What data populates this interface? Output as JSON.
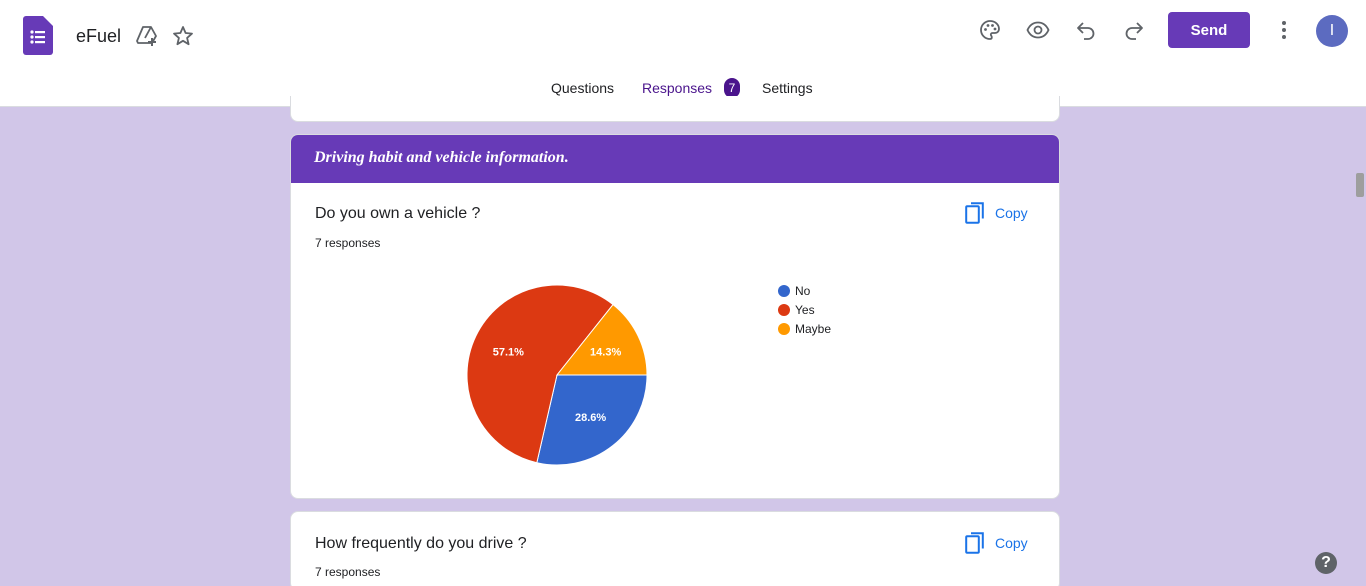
{
  "app": {
    "title": "eFuel",
    "avatar_initial": "I"
  },
  "toolbar": {
    "send_label": "Send"
  },
  "tabs": [
    {
      "label": "Questions",
      "active": false
    },
    {
      "label": "Responses",
      "active": true,
      "badge": "7"
    },
    {
      "label": "Settings",
      "active": false
    }
  ],
  "section": {
    "title": "Driving habit and vehicle information."
  },
  "questions": [
    {
      "title": "Do you own a vehicle ?",
      "responses": "7 responses",
      "copy_label": "Copy",
      "chart_data": {
        "type": "pie",
        "slices": [
          {
            "label": "No",
            "value": 28.6,
            "display": "28.6%",
            "color": "#3366cc"
          },
          {
            "label": "Yes",
            "value": 57.1,
            "display": "57.1%",
            "color": "#dc3912"
          },
          {
            "label": "Maybe",
            "value": 14.3,
            "display": "14.3%",
            "color": "#ff9900"
          }
        ],
        "legend_position": "right"
      }
    },
    {
      "title": "How frequently do you drive ?",
      "responses": "7 responses",
      "copy_label": "Copy"
    }
  ],
  "colors": {
    "accent": "#673ab7",
    "background": "#d1c6e8",
    "link": "#1a73e8"
  },
  "icons": [
    "forms-logo-icon",
    "add-to-drive-icon",
    "star-icon",
    "palette-icon",
    "preview-eye-icon",
    "undo-icon",
    "redo-icon",
    "more-vert-icon",
    "copy-icon",
    "help-icon"
  ]
}
